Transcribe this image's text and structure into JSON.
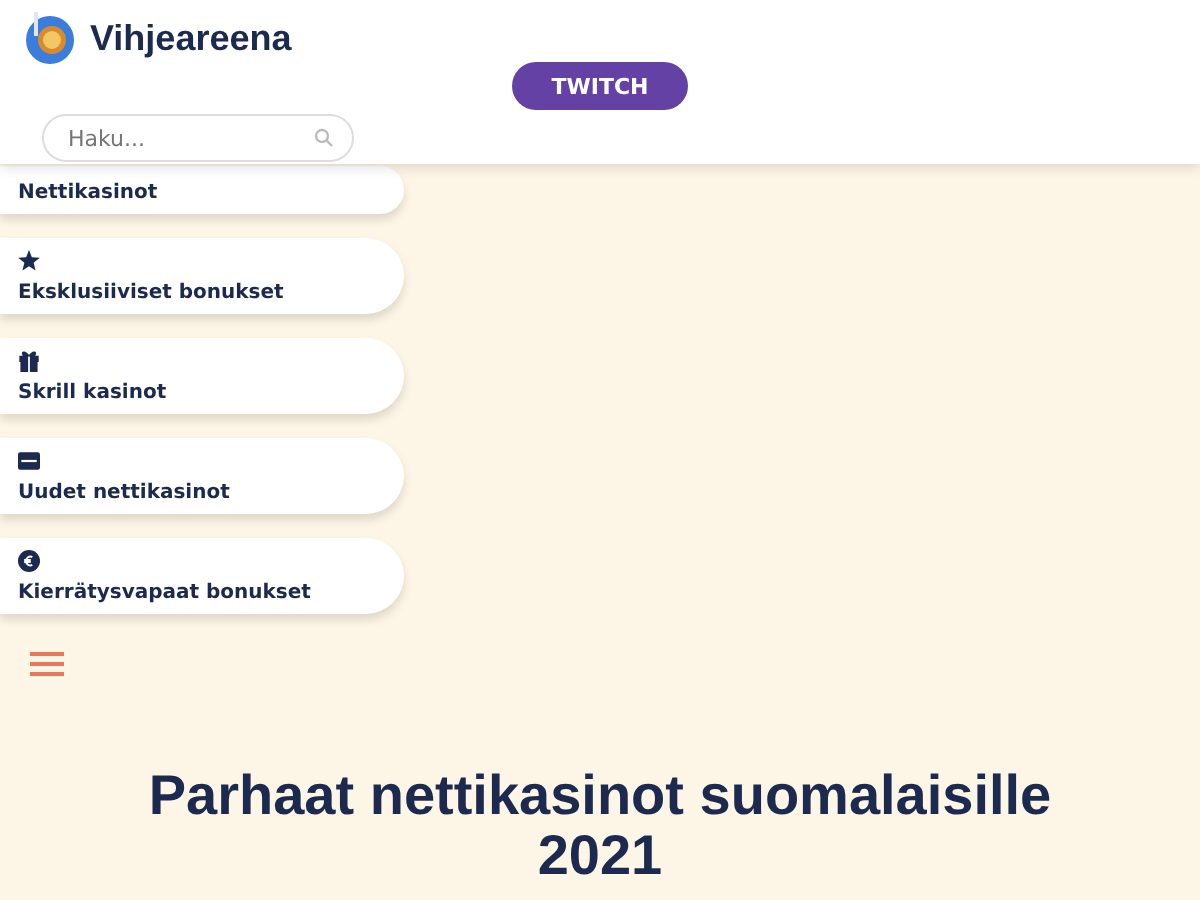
{
  "header": {
    "logo_text": "Vihjeareena",
    "button": "TWITCH",
    "search": {
      "placeholder": "Haku..."
    }
  },
  "menu": [
    {
      "label": "Nettikasinot",
      "kind": "plain"
    },
    {
      "label": "Eksklusiiviset bonukset",
      "kind": "star"
    },
    {
      "label": "Skrill kasinot",
      "kind": "gift"
    },
    {
      "label": "Uudet nettikasinot",
      "kind": "new"
    },
    {
      "label": "Kierrätysvapaat bonukset",
      "kind": "euro"
    }
  ],
  "heading": "Parhaat nettikasinot suomalaisille 2021"
}
